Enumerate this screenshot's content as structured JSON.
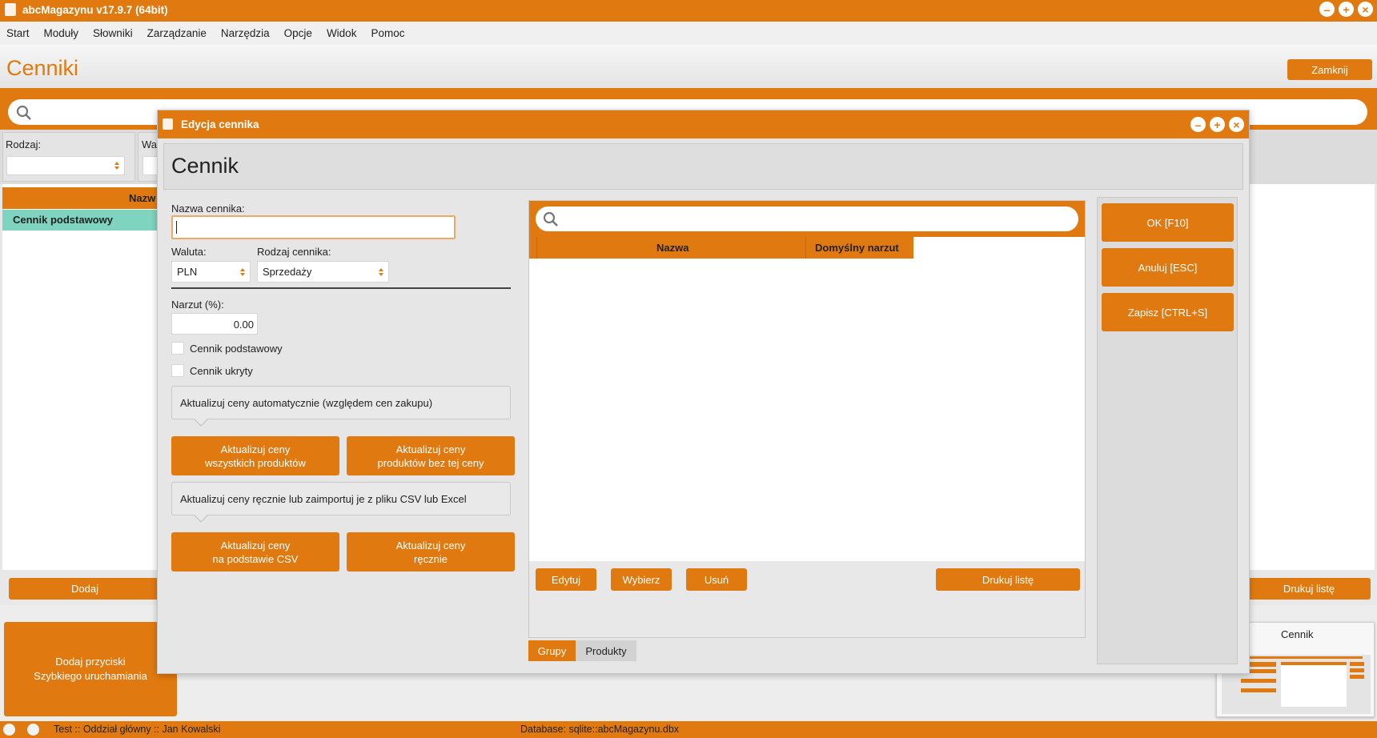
{
  "app": {
    "title": "abcMagazynu v17.9.7 (64bit)",
    "accent_color": "#e07a10",
    "menu": [
      "Start",
      "Moduły",
      "Słowniki",
      "Zarządzanie",
      "Narzędzia",
      "Opcje",
      "Widok",
      "Pomoc"
    ]
  },
  "page": {
    "title": "Cenniki",
    "close_label": "Zamknij",
    "filters": {
      "rodzaj_label": "Rodzaj:",
      "waluta_label_partial": "Wa"
    },
    "table": {
      "header_partial": "Nazw",
      "rows": [
        "Cennik podstawowy"
      ]
    },
    "add_label": "Dodaj",
    "print_label": "Drukuj listę",
    "quick_launch_label": "Dodaj przyciski\nSzybkiego uruchamiania",
    "thumbnail_title": "Cennik"
  },
  "dialog": {
    "title": "Edycja cennika",
    "heading": "Cennik",
    "name_label": "Nazwa cennika:",
    "name_value": "",
    "currency_label": "Waluta:",
    "currency_value": "PLN",
    "type_label": "Rodzaj cennika:",
    "type_value": "Sprzedaży",
    "markup_label": "Narzut (%):",
    "markup_value": "0.00",
    "checkbox_basic": "Cennik podstawowy",
    "checkbox_hidden": "Cennik ukryty",
    "auto_info": "Aktualizuj ceny automatycznie (względem cen zakupu)",
    "btn_all_products": "Aktualizuj ceny\nwszystkich produktów",
    "btn_no_price": "Aktualizuj ceny\nproduktów bez tej ceny",
    "manual_info": "Aktualizuj ceny ręcznie lub zaimportuj je z pliku CSV lub Excel",
    "btn_csv": "Aktualizuj ceny\nna podstawie CSV",
    "btn_manual": "Aktualizuj ceny\nręcznie",
    "grid_columns": [
      "Nazwa",
      "Domyślny narzut"
    ],
    "edit_label": "Edytuj",
    "choose_label": "Wybierz",
    "delete_label": "Usuń",
    "print_label": "Drukuj listę",
    "tabs": [
      "Grupy",
      "Produkty"
    ],
    "ok_label": "OK [F10]",
    "cancel_label": "Anuluj [ESC]",
    "save_label": "Zapisz [CTRL+S]"
  },
  "status": {
    "user": "Test :: Oddział główny :: Jan Kowalski",
    "database": "Database: sqlite::abcMagazynu.dbx"
  }
}
